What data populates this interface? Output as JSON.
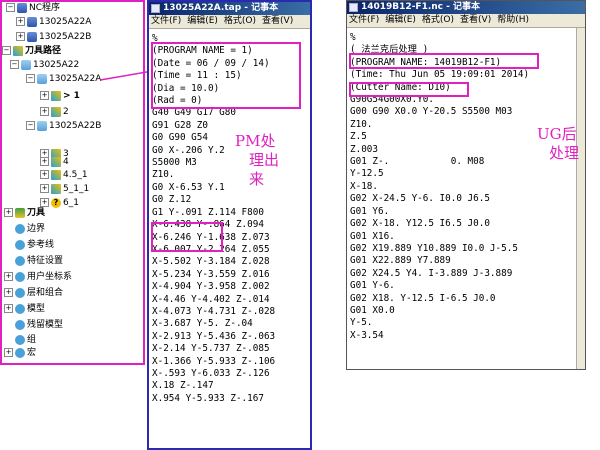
{
  "tree": {
    "items": [
      {
        "label": "NC程序",
        "icon": "nc-program-icon",
        "expander": "−"
      },
      {
        "label": "13025A22A",
        "icon": "nc-file-icon",
        "expander": "+"
      },
      {
        "label": "13025A22B",
        "icon": "nc-file-icon",
        "expander": "+"
      },
      {
        "label": "刀具路径",
        "icon": "toolpath-icon",
        "expander": "−"
      },
      {
        "label": "13025A22",
        "icon": "folder-icon",
        "expander": "−"
      },
      {
        "label": "13025A22A",
        "icon": "folder-icon",
        "expander": "−"
      },
      {
        "label": "> 1",
        "icon": "toolpath-item-icon",
        "expander": "+"
      },
      {
        "label": "2",
        "icon": "toolpath-item-icon",
        "expander": "+"
      },
      {
        "label": "13025A22B",
        "icon": "folder-icon",
        "expander": "−"
      },
      {
        "label": "3",
        "icon": "toolpath-item-icon",
        "expander": "+"
      },
      {
        "label": "4",
        "icon": "toolpath-item-icon",
        "expander": "+"
      },
      {
        "label": "4.5_1",
        "icon": "toolpath-item-icon",
        "expander": "+"
      },
      {
        "label": "5_1_1",
        "icon": "toolpath-item-icon",
        "expander": "+"
      },
      {
        "label": "6_1",
        "icon": "question-icon",
        "expander": "+"
      },
      {
        "label": "刀具",
        "icon": "tool-icon",
        "expander": "+"
      },
      {
        "label": "边界",
        "icon": "boundary-icon",
        "expander": ""
      },
      {
        "label": "参考线",
        "icon": "reference-line-icon",
        "expander": ""
      },
      {
        "label": "特征设置",
        "icon": "feature-set-icon",
        "expander": ""
      },
      {
        "label": "用户坐标系",
        "icon": "user-coordinate-icon",
        "expander": "+"
      },
      {
        "label": "层和组合",
        "icon": "layers-icon",
        "expander": "+"
      },
      {
        "label": "模型",
        "icon": "model-icon",
        "expander": "+"
      },
      {
        "label": "残留模型",
        "icon": "stock-model-icon",
        "expander": ""
      },
      {
        "label": "组",
        "icon": "group-icon",
        "expander": ""
      },
      {
        "label": "宏",
        "icon": "macro-icon",
        "expander": "+"
      }
    ]
  },
  "win1": {
    "title": "13025A22A.tap - 记事本",
    "menu": [
      "文件(F)",
      "编辑(E)",
      "格式(O)",
      "查看(V)"
    ],
    "lines": [
      "%",
      "(PROGRAM NAME = 1)",
      "(Date = 06 / 09 / 14)",
      "(Time = 11 : 15)",
      "(Dia = 10.0)",
      "(Rad = 0)",
      "G40 G49 G17 G80",
      "G91 G28 Z0",
      "G0 G90 G54",
      "G0 X-.206 Y.2",
      "S5000 M3",
      "Z10.",
      "G0 X-6.53 Y.1",
      "G0 Z.12",
      "G1 Y-.091 Z.114 F800",
      "X-6.438 Y-.864 Z.094",
      "X-6.246 Y-1.638 Z.073",
      "X-6.007 Y-2.264 Z.055",
      "X-5.502 Y-3.184 Z.028",
      "X-5.234 Y-3.559 Z.016",
      "X-4.904 Y-3.958 Z.002",
      "X-4.46 Y-4.402 Z-.014",
      "X-4.073 Y-4.731 Z-.028",
      "X-3.687 Y-5. Z-.04",
      "X-2.913 Y-5.436 Z-.063",
      "X-2.14 Y-5.737 Z-.085",
      "X-1.366 Y-5.933 Z-.106",
      "X-.593 Y-6.033 Z-.126",
      "X.18 Z-.147",
      "X.954 Y-5.933 Z-.167"
    ]
  },
  "win2": {
    "title": "14019B12-F1.nc - 记事本",
    "menu": [
      "文件(F)",
      "编辑(E)",
      "格式(O)",
      "查看(V)",
      "帮助(H)"
    ],
    "lines": [
      "%",
      "( 法兰克后处理 )",
      "(PROGRAM NAME: 14019B12-F1)",
      "(Time: Thu Jun 05 19:09:01 2014)",
      "(Cutter Name: D10)",
      "G90G54G00X0.Y0.",
      "G00 G90 X0.0 Y-20.5 S5500 M03",
      "Z10.",
      "Z.5",
      "Z.003",
      "G01 Z-.           0. M08",
      "Y-12.5",
      "X-18.",
      "G02 X-24.5 Y-6. I0.0 J6.5",
      "G01 Y6.",
      "G02 X-18. Y12.5 I6.5 J0.0",
      "G01 X16.",
      "G02 X19.889 Y10.889 I0.0 J-5.5",
      "G01 X22.889 Y7.889",
      "G02 X24.5 Y4. I-3.889 J-3.889",
      "G01 Y-6.",
      "G02 X18. Y-12.5 I-6.5 J0.0",
      "G01 X0.0",
      "Y-5.",
      "X-3.54"
    ]
  },
  "annotations": {
    "pm": [
      "PM处",
      "理出",
      "来"
    ],
    "ug": [
      "UG后",
      "处理"
    ]
  },
  "colors": {
    "annotation": "#e020c0",
    "win1_border": "#2a2ab0"
  }
}
